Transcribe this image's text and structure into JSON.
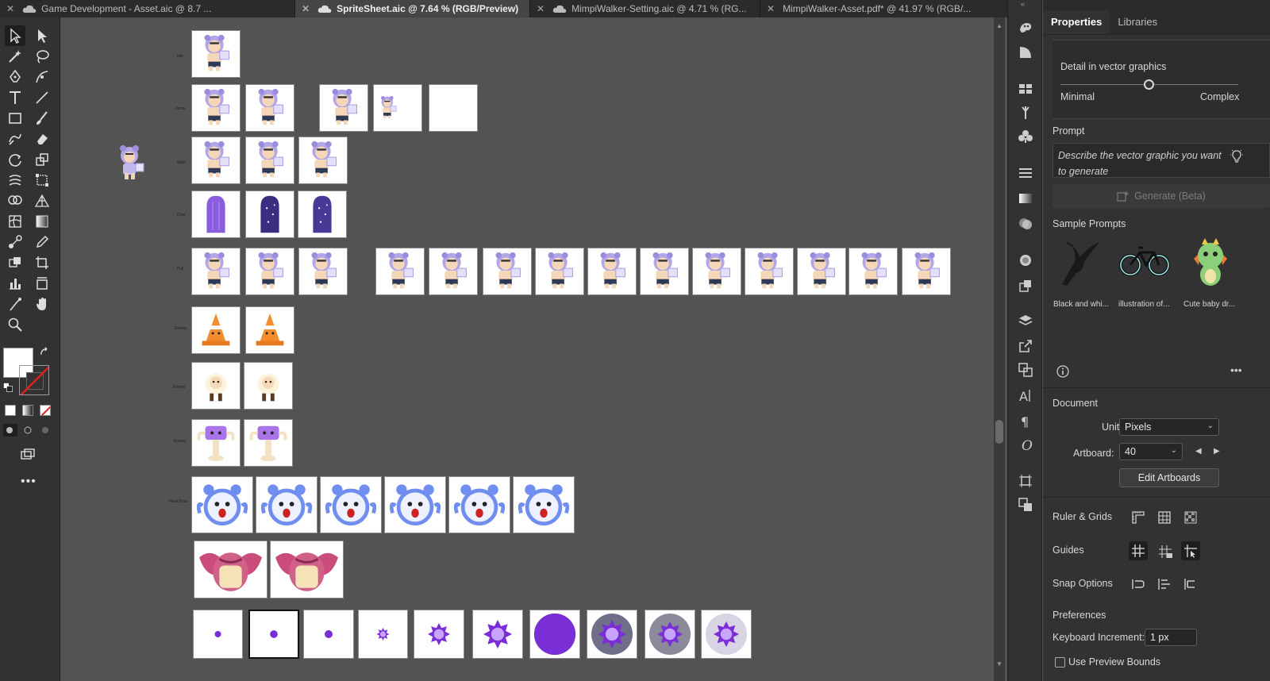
{
  "tabs": [
    {
      "label": "Game Development - Asset.aic @ 8.7 ...",
      "active": false
    },
    {
      "label": "SpriteSheet.aic @ 7.64 % (RGB/Preview)",
      "active": true
    },
    {
      "label": "MimpiWalker-Setting.aic @ 4.71 % (RG...",
      "active": false
    },
    {
      "label": "MimpiWalker-Asset.pdf* @ 41.97 % (RGB/...",
      "active": false
    }
  ],
  "canvas": {
    "row_labels": [
      "Idle",
      "Jump",
      "Walk",
      "Door",
      "Pull",
      "Enemy",
      "Enemy",
      "Enemy",
      "Final Boss"
    ]
  },
  "panel": {
    "tabs": [
      "Properties",
      "Libraries"
    ],
    "detail_label": "Detail in vector graphics",
    "slider_min": "Minimal",
    "slider_max": "Complex",
    "prompt_title": "Prompt",
    "prompt_placeholder": "Describe the vector graphic you want to generate",
    "generate_label": "Generate (Beta)",
    "sample_title": "Sample Prompts",
    "samples": [
      "Black and whi...",
      "illustration of...",
      "Cute baby dr..."
    ],
    "document_title": "Document",
    "units_label": "Units:",
    "units_value": "Pixels",
    "artboard_label": "Artboard:",
    "artboard_value": "40",
    "edit_artboards": "Edit Artboards",
    "ruler_grids": "Ruler & Grids",
    "guides": "Guides",
    "snap_options": "Snap Options",
    "preferences": "Preferences",
    "keyboard_increment_label": "Keyboard Increment:",
    "keyboard_increment_value": "1 px",
    "use_preview_bounds": "Use Preview Bounds"
  },
  "colors": {
    "accent": "#7b5cc9",
    "ui_dark": "#323232",
    "canvas": "#535353"
  }
}
